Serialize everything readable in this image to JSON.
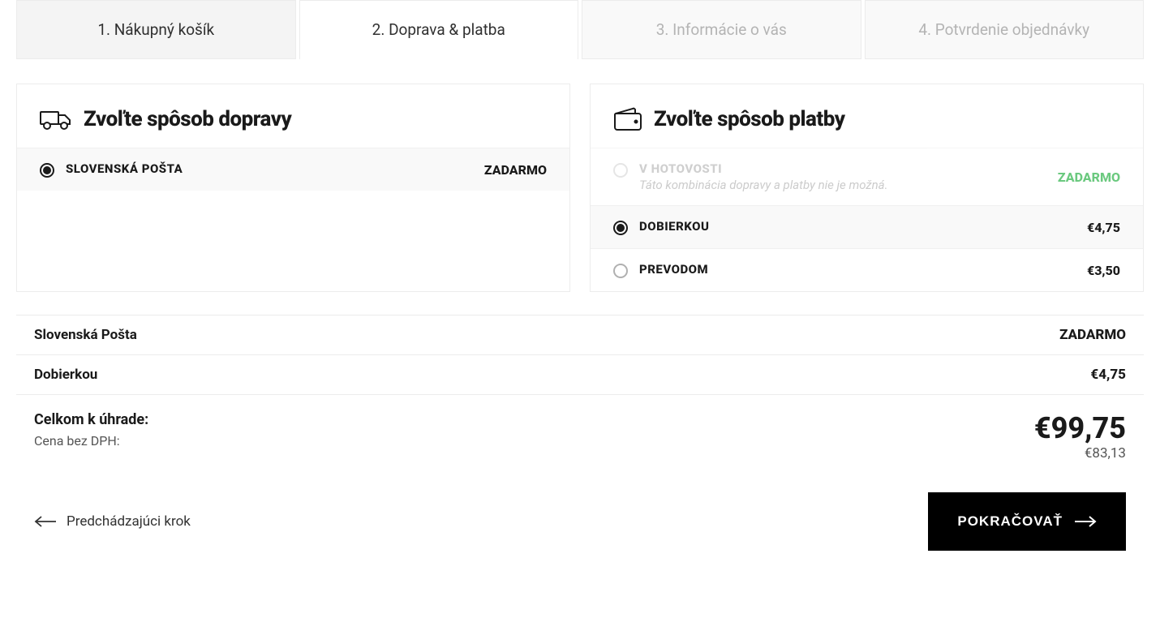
{
  "steps": [
    {
      "label": "1. Nákupný košík"
    },
    {
      "label": "2. Doprava & platba"
    },
    {
      "label": "3. Informácie o vás"
    },
    {
      "label": "4. Potvrdenie objednávky"
    }
  ],
  "shipping": {
    "title": "Zvoľte spôsob dopravy",
    "options": [
      {
        "title": "SLOVENSKÁ POŠTA",
        "price": "ZADARMO"
      }
    ]
  },
  "payment": {
    "title": "Zvoľte spôsob platby",
    "options": [
      {
        "title": "V HOTOVOSTI",
        "note": "Táto kombinácia dopravy a platby nie je možná.",
        "price": "ZADARMO"
      },
      {
        "title": "DOBIERKOU",
        "price": "€4,75"
      },
      {
        "title": "PREVODOM",
        "price": "€3,50"
      }
    ]
  },
  "summary": {
    "rows": [
      {
        "label": "Slovenská Pošta",
        "value": "ZADARMO"
      },
      {
        "label": "Dobierkou",
        "value": "€4,75"
      }
    ],
    "total_label": "Celkom k úhrade:",
    "total_value": "€99,75",
    "novat_label": "Cena bez DPH:",
    "novat_value": "€83,13"
  },
  "nav": {
    "back": "Predchádzajúci krok",
    "continue": "POKRAČOVAŤ"
  }
}
